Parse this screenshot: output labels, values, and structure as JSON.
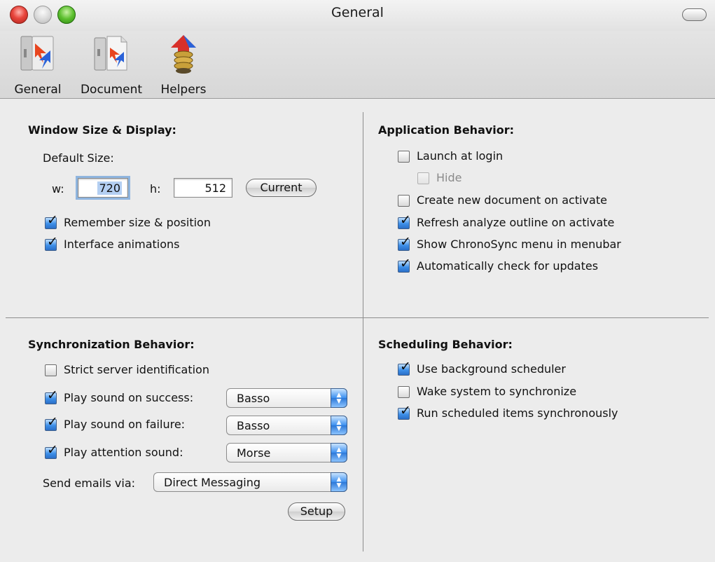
{
  "window": {
    "title": "General"
  },
  "toolbar": {
    "items": [
      {
        "label": "General",
        "icon": "general-prefs-icon"
      },
      {
        "label": "Document",
        "icon": "document-prefs-icon"
      },
      {
        "label": "Helpers",
        "icon": "helpers-icon"
      }
    ]
  },
  "window_size": {
    "title": "Window Size & Display:",
    "default_size_label": "Default Size:",
    "w_label": "w:",
    "w_value": "720",
    "h_label": "h:",
    "h_value": "512",
    "current_button": "Current",
    "remember": {
      "label": "Remember size & position",
      "checked": true
    },
    "animations": {
      "label": "Interface animations",
      "checked": true
    }
  },
  "app_behavior": {
    "title": "Application Behavior:",
    "launch_at_login": {
      "label": "Launch at login",
      "checked": false
    },
    "hide": {
      "label": "Hide",
      "checked": false,
      "disabled": true
    },
    "create_new_doc": {
      "label": "Create new document on activate",
      "checked": false
    },
    "refresh_outline": {
      "label": "Refresh analyze outline on activate",
      "checked": true
    },
    "show_menu": {
      "label": "Show ChronoSync menu in menubar",
      "checked": true
    },
    "auto_check": {
      "label": "Automatically check for updates",
      "checked": true
    }
  },
  "sync_behavior": {
    "title": "Synchronization Behavior:",
    "strict_server": {
      "label": "Strict server identification",
      "checked": false
    },
    "sound_success": {
      "label": "Play sound on success:",
      "checked": true,
      "value": "Basso"
    },
    "sound_failure": {
      "label": "Play sound on failure:",
      "checked": true,
      "value": "Basso"
    },
    "attention_sound": {
      "label": "Play attention sound:",
      "checked": true,
      "value": "Morse"
    },
    "send_emails_label": "Send emails via:",
    "send_emails_value": "Direct Messaging",
    "setup_button": "Setup"
  },
  "scheduling": {
    "title": "Scheduling Behavior:",
    "background_scheduler": {
      "label": "Use background scheduler",
      "checked": true
    },
    "wake_system": {
      "label": "Wake system to synchronize",
      "checked": false
    },
    "run_sync": {
      "label": "Run scheduled items synchronously",
      "checked": true
    }
  },
  "colors": {
    "accent": "#3d8fe8",
    "checkbox_checked": "#3d8fe8",
    "divider": "#8d8d8d"
  }
}
